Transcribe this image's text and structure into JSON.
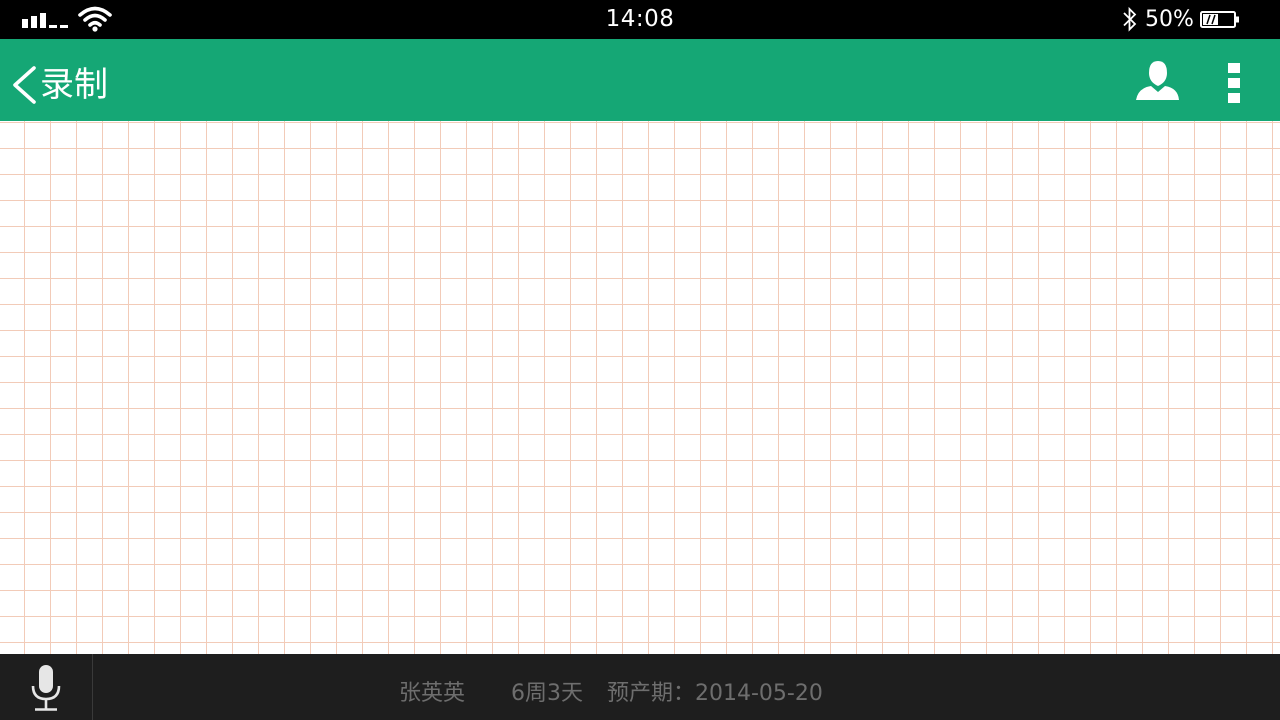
{
  "status_bar": {
    "time": "14:08",
    "battery_percent": "50%",
    "battery_level": 0.5,
    "signal_icon": "cellular-signal-icon",
    "wifi_icon": "wifi-icon",
    "bluetooth_icon": "bluetooth-icon",
    "battery_icon": "battery-icon"
  },
  "app_bar": {
    "back_icon": "chevron-left-icon",
    "title": "录制",
    "profile_icon": "person-icon",
    "more_icon": "more-vertical-icon",
    "color": "#15a775"
  },
  "canvas": {
    "grid_line_color": "#f2cbb8"
  },
  "bottom_bar": {
    "mic_icon": "microphone-icon",
    "patient_name": "张英英",
    "gestation": "6周3天",
    "due_date_label": "预产期：",
    "due_date": "2014-05-20"
  }
}
